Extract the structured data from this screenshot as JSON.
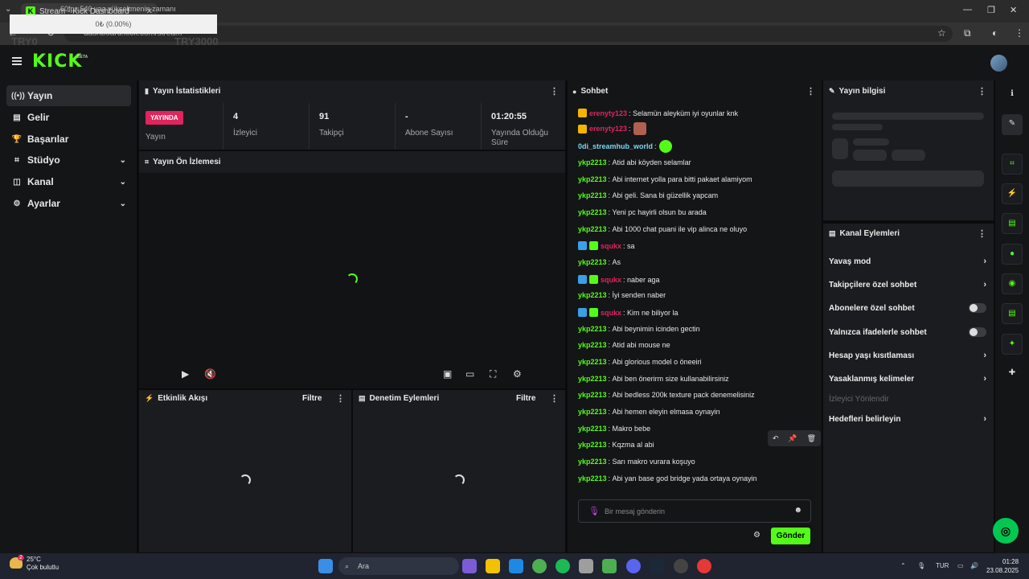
{
  "browser": {
    "tab_title": "Stream - Kick Dashboard",
    "tab_overlay": "60fps 540 yaa yükseltmenin zamanı",
    "url": "dashboard.kick.com/stream",
    "popup_value": "0₺ (0.00%)",
    "overlay_left": "TRY0",
    "overlay_right": "TRY3000"
  },
  "header": {
    "logo": "KICK",
    "beta": "BETA"
  },
  "sidebar": {
    "items": [
      {
        "label": "Yayın",
        "icon": "((•))"
      },
      {
        "label": "Gelir",
        "icon": "▤"
      },
      {
        "label": "Başarılar",
        "icon": "🏆"
      },
      {
        "label": "Stüdyo",
        "icon": "⌗"
      },
      {
        "label": "Kanal",
        "icon": "◫"
      },
      {
        "label": "Ayarlar",
        "icon": "⚙"
      }
    ]
  },
  "stats": {
    "title": "Yayın İstatistikleri",
    "live_badge": "YAYINDA",
    "live_label": "Yayın",
    "viewers": {
      "value": "4",
      "label": "İzleyici"
    },
    "followers": {
      "value": "91",
      "label": "Takipçi"
    },
    "subs": {
      "value": "-",
      "label": "Abone Sayısı"
    },
    "uptime": {
      "value": "01:20:55",
      "label": "Yayında Olduğu Süre"
    }
  },
  "preview": {
    "title": "Yayın Ön İzlemesi"
  },
  "activity": {
    "title": "Etkinlik Akışı",
    "filter": "Filtre"
  },
  "moderation": {
    "title": "Denetim Eylemleri",
    "filter": "Filtre"
  },
  "chat": {
    "title": "Sohbet",
    "messages": [
      {
        "user": "erenyty123",
        "text": "Selamün aleyküm iyi oyunlar knk"
      },
      {
        "user": "erenyty123",
        "text": ""
      },
      {
        "user": "0di_streamhub_world",
        "text": ""
      },
      {
        "user": "ykp2213",
        "text": "Atid abi köyden selamlar"
      },
      {
        "user": "ykp2213",
        "text": "Abi internet yolla para bitti pakaet alamiyom"
      },
      {
        "user": "ykp2213",
        "text": "Abi geli. Sana bi güzellik yapcam"
      },
      {
        "user": "ykp2213",
        "text": "Yeni pc hayirli olsun bu arada"
      },
      {
        "user": "ykp2213",
        "text": "Abi 1000 chat puani ile vip alinca ne oluyo"
      },
      {
        "user": "squkx",
        "text": "sa"
      },
      {
        "user": "ykp2213",
        "text": "As"
      },
      {
        "user": "squkx",
        "text": "naber aga"
      },
      {
        "user": "ykp2213",
        "text": "İyi senden naber"
      },
      {
        "user": "squkx",
        "text": "Kim ne biliyor la"
      },
      {
        "user": "ykp2213",
        "text": "Abi beynimin icinden gectin"
      },
      {
        "user": "ykp2213",
        "text": "Atid abi mouse ne"
      },
      {
        "user": "ykp2213",
        "text": "Abi glorious model o öneeiri"
      },
      {
        "user": "ykp2213",
        "text": "Abi ben önerirm size kullanabilirsiniz"
      },
      {
        "user": "ykp2213",
        "text": "Abi bedless 200k texture pack denemelisiniz"
      },
      {
        "user": "ykp2213",
        "text": "Abi hemen eleyin elmasa oynayin"
      },
      {
        "user": "ykp2213",
        "text": "Makro bebe"
      },
      {
        "user": "ykp2213",
        "text": "Kqzma al abi"
      },
      {
        "user": "ykp2213",
        "text": "Sarı makro vurara koşuyo"
      },
      {
        "user": "ykp2213",
        "text": "Abi yan base god bridge yada ortaya oynayin"
      }
    ],
    "input_placeholder": "Bir mesaj gönderin",
    "send_label": "Gönder"
  },
  "info": {
    "title": "Yayın bilgisi"
  },
  "channel_actions": {
    "title": "Kanal Eylemleri",
    "items": [
      {
        "label": "Yavaş mod",
        "kind": "chevron"
      },
      {
        "label": "Takipçilere özel sohbet",
        "kind": "chevron"
      },
      {
        "label": "Abonelere özel sohbet",
        "kind": "toggle"
      },
      {
        "label": "Yalnızca ifadelerle sohbet",
        "kind": "toggle"
      },
      {
        "label": "Hesap yaşı kısıtlaması",
        "kind": "chevron"
      },
      {
        "label": "Yasaklanmış kelimeler",
        "kind": "chevron"
      },
      {
        "label": "İzleyici Yönlendir",
        "kind": "disabled"
      },
      {
        "label": "Hedefleri belirleyin",
        "kind": "chevron"
      }
    ]
  },
  "taskbar": {
    "temp": "25°C",
    "weather": "Çok bulutlu",
    "search": "Ara",
    "lang": "TUR",
    "time": "01:28",
    "date": "23.08.2025",
    "notif": "2"
  },
  "colors": {
    "accent": "#53fc18",
    "live": "#e0245e"
  }
}
